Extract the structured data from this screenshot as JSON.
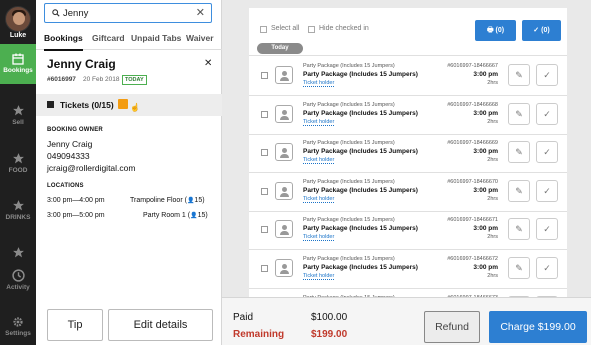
{
  "nav": {
    "user_name": "Luke",
    "items": [
      {
        "label": "Bookings",
        "icon": "calendar-icon",
        "active": true
      },
      {
        "label": "Sell",
        "icon": "star-icon"
      },
      {
        "label": "FOOD",
        "icon": "star-icon"
      },
      {
        "label": "DRINKS",
        "icon": "star-icon"
      },
      {
        "label": "",
        "icon": "star-icon"
      },
      {
        "label": "Activity",
        "icon": "clock-icon"
      },
      {
        "label": "Settings",
        "icon": "gear-icon"
      }
    ]
  },
  "search": {
    "value": "Jenny"
  },
  "tabs": [
    "Bookings",
    "Giftcard",
    "Unpaid Tabs",
    "Waiver"
  ],
  "booking": {
    "name": "Jenny Craig",
    "number": "#6016997",
    "date": "20 Feb 2018",
    "badge": "TODAY",
    "tickets_label": "Tickets (0/15)",
    "owner_header": "BOOKING OWNER",
    "owner_name": "Jenny Craig",
    "owner_phone": "049094333",
    "owner_email": "jcraig@rollerdigital.com",
    "locations_header": "LOCATIONS",
    "locations": [
      {
        "time": "3:00 pm—4:00 pm",
        "place": "Trampoline Floor (",
        "count": "15)"
      },
      {
        "time": "3:00 pm—5:00 pm",
        "place": "Party Room 1 (",
        "count": "15)"
      }
    ]
  },
  "panel_buttons": {
    "tip": "Tip",
    "edit": "Edit details"
  },
  "toolbar": {
    "select_all": "Select all",
    "hide_checked": "Hide checked in",
    "print_count": "(0)",
    "check_count": "(0)"
  },
  "today_label": "Today",
  "ticket_rows": [
    {
      "line1": "Party Package (Includes 15 Jumpers)",
      "line2": "Party Package (Includes 15 Jumpers)",
      "link": "Ticket holder",
      "id": "#6016997-18466667",
      "time": "3:00 pm",
      "duration": "2hrs"
    },
    {
      "line1": "Party Package (Includes 15 Jumpers)",
      "line2": "Party Package (Includes 15 Jumpers)",
      "link": "Ticket holder",
      "id": "#6016997-18466668",
      "time": "3:00 pm",
      "duration": "2hrs"
    },
    {
      "line1": "Party Package (Includes 15 Jumpers)",
      "line2": "Party Package (Includes 15 Jumpers)",
      "link": "Ticket holder",
      "id": "#6016997-18466669",
      "time": "3:00 pm",
      "duration": "2hrs"
    },
    {
      "line1": "Party Package (Includes 15 Jumpers)",
      "line2": "Party Package (Includes 15 Jumpers)",
      "link": "Ticket holder",
      "id": "#6016997-18466670",
      "time": "3:00 pm",
      "duration": "2hrs"
    },
    {
      "line1": "Party Package (Includes 15 Jumpers)",
      "line2": "Party Package (Includes 15 Jumpers)",
      "link": "Ticket holder",
      "id": "#6016997-18466671",
      "time": "3:00 pm",
      "duration": "2hrs"
    },
    {
      "line1": "Party Package (Includes 15 Jumpers)",
      "line2": "Party Package (Includes 15 Jumpers)",
      "link": "Ticket holder",
      "id": "#6016997-18466672",
      "time": "3:00 pm",
      "duration": "2hrs"
    },
    {
      "line1": "Party Package (Includes 15 Jumpers)",
      "line2": "",
      "link": "",
      "id": "#6016997-18466673",
      "time": "",
      "duration": ""
    }
  ],
  "payment": {
    "paid_label": "Paid",
    "paid_value": "$100.00",
    "remaining_label": "Remaining",
    "remaining_value": "$199.00",
    "refund_label": "Refund",
    "charge_label": "Charge $199.00"
  },
  "colors": {
    "accent": "#2d7fd2",
    "nav_active": "#4caf50",
    "remaining": "#c0392b"
  }
}
